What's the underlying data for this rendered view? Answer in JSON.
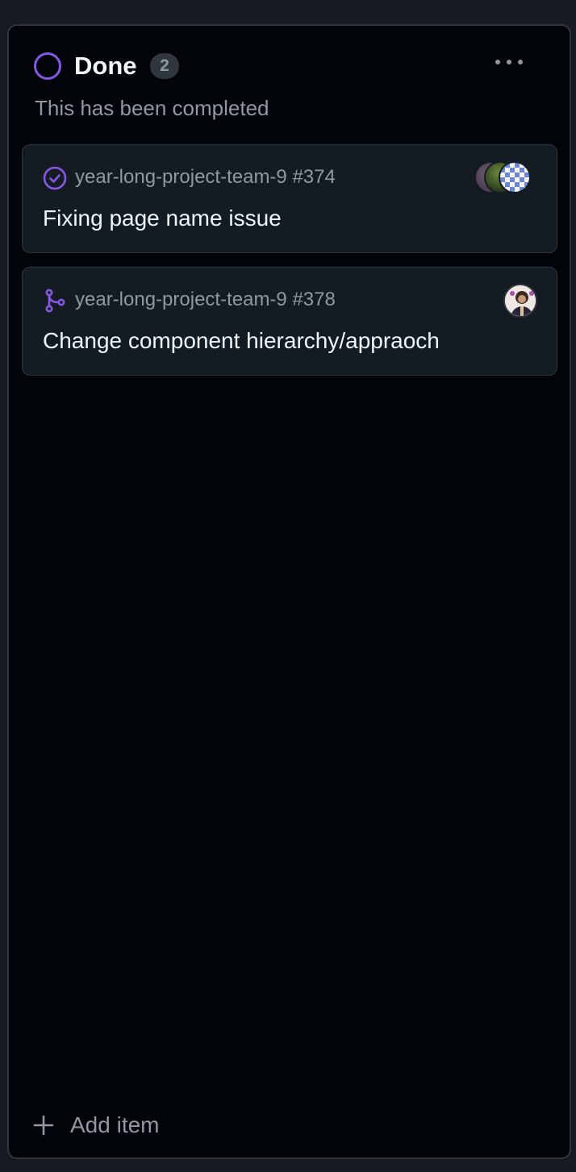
{
  "column": {
    "title": "Done",
    "count": "2",
    "description": "This has been completed",
    "status_color": "#8957e5"
  },
  "cards": [
    {
      "repo_ref": "year-long-project-team-9 #374",
      "title": "Fixing page name issue",
      "type_icon": "issue-closed-icon",
      "assignee_count": 3
    },
    {
      "repo_ref": "year-long-project-team-9 #378",
      "title": "Change component hierarchy/appraoch",
      "type_icon": "pull-request-merged-icon",
      "assignee_count": 1
    }
  ],
  "footer": {
    "add_label": "Add item"
  },
  "colors": {
    "accent_purple": "#8957e5",
    "background": "#010409",
    "card_background": "#151b23",
    "border": "#30363d",
    "text_primary": "#f0f6fc",
    "text_muted": "#9198a1"
  }
}
